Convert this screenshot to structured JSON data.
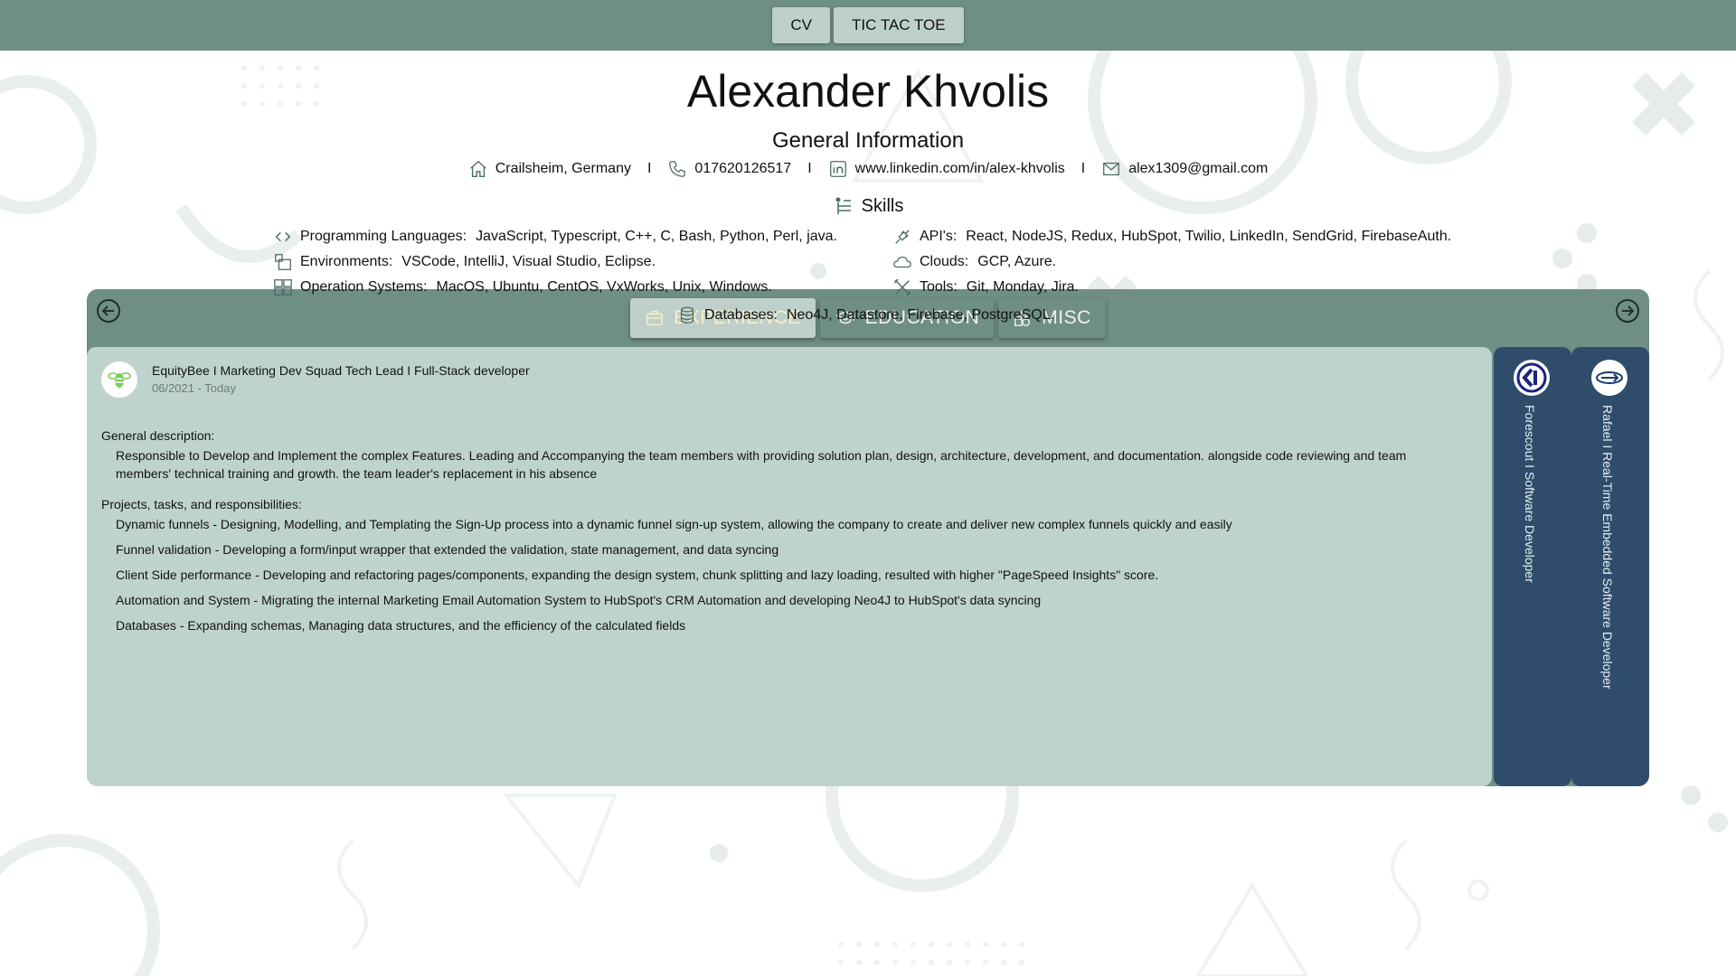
{
  "nav": {
    "cv_label": "CV",
    "tictactoe_label": "TIC TAC TOE"
  },
  "profile": {
    "name": "Alexander Khvolis",
    "general_title": "General Information",
    "location": "Crailsheim, Germany",
    "phone": "017620126517",
    "linkedin": "www.linkedin.com/in/alex-khvolis",
    "email": "alex1309@gmail.com",
    "separator": "I"
  },
  "skills": {
    "title": "Skills",
    "languages": {
      "label": "Programming Languages:",
      "value": "JavaScript, Typescript, C++, C, Bash, Python, Perl, java."
    },
    "environments": {
      "label": "Environments:",
      "value": "VSCode, IntelliJ, Visual Studio, Eclipse."
    },
    "os": {
      "label": "Operation Systems:",
      "value": "MacOS, Ubuntu, CentOS, VxWorks, Unix, Windows."
    },
    "apis": {
      "label": "API's:",
      "value": "React, NodeJS, Redux, HubSpot, Twilio, LinkedIn, SendGrid, FirebaseAuth."
    },
    "clouds": {
      "label": "Clouds:",
      "value": "GCP, Azure."
    },
    "tools": {
      "label": "Tools:",
      "value": "Git, Monday, Jira."
    },
    "databases": {
      "label": "Databases:",
      "value": "Neo4J, Datastore, Firebase, PostgreSQL."
    }
  },
  "tabs": [
    {
      "label": "EXPERIENCE",
      "icon": "briefcase-icon",
      "active": true
    },
    {
      "label": "EDUCATION",
      "icon": "graduation-cap-icon",
      "active": false
    },
    {
      "label": "MISC",
      "icon": "shapes-icon",
      "active": false
    }
  ],
  "experience": {
    "title": "EquityBee I Marketing Dev Squad Tech Lead I Full-Stack developer",
    "date": "06/2021 - Today",
    "general_heading": "General description:",
    "general_text": "Responsible to Develop and Implement the complex Features. Leading and Accompanying the team members with providing solution plan, design, architecture, development, and documentation. alongside code reviewing and team members' technical training and growth. the team leader's replacement in his absence",
    "projects_heading": "Projects, tasks, and responsibilities:",
    "projects": [
      "Dynamic funnels - Designing, Modelling, and Templating the Sign-Up process into a dynamic funnel sign-up system, allowing the company to create and deliver new complex funnels quickly and easily",
      "Funnel validation - Developing a form/input wrapper that extended the validation, state management, and data syncing",
      "Client Side performance - Developing and refactoring pages/components, expanding the design system, chunk splitting and lazy loading, resulted with higher \"PageSpeed Insights\" score.",
      "Automation and System - Migrating the internal Marketing Email Automation System to HubSpot's CRM Automation and developing Neo4J to HubSpot's data syncing",
      "Databases - Expanding schemas, Managing data structures, and the efficiency of the calculated fields"
    ]
  },
  "side_jobs": [
    {
      "label": "Forescout I Software Developer"
    },
    {
      "label": "Rafael I Real-Time Embedded Software Developer"
    }
  ],
  "colors": {
    "topbar": "#6f8f84",
    "card": "#bfd3ce",
    "side_tab": "#2f4c6b",
    "active_tab_text": "#f6f0c8"
  }
}
